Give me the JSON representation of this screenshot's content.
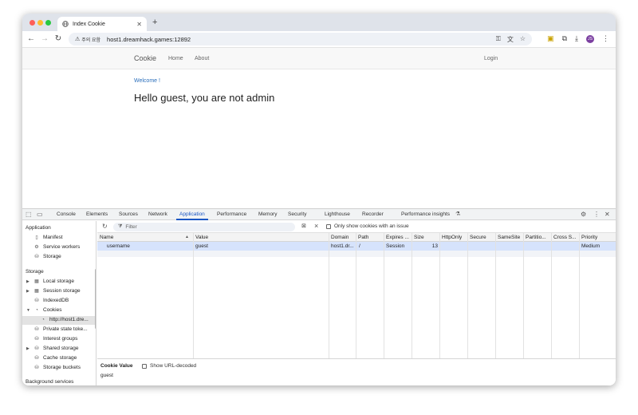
{
  "browser": {
    "tab_title": "Index Cookie",
    "new_tab": "+",
    "tab_close": "✕",
    "security_warning": "주의 요함",
    "url": "host1.dreamhack.games:12892",
    "profile_initials": "JS"
  },
  "page": {
    "brand": "Cookie",
    "nav": {
      "home": "Home",
      "about": "About",
      "login": "Login"
    },
    "welcome": "Welcome !",
    "message": "Hello guest, you are not admin"
  },
  "devtools": {
    "tabs": [
      "Console",
      "Elements",
      "Sources",
      "Network",
      "Application",
      "Performance",
      "Memory",
      "Security",
      "Lighthouse",
      "Recorder",
      "Performance insights"
    ],
    "active_tab": "Application",
    "sidebar": {
      "application_heading": "Application",
      "application_items": [
        "Manifest",
        "Service workers",
        "Storage"
      ],
      "storage_heading": "Storage",
      "storage_items": [
        "Local storage",
        "Session storage",
        "IndexedDB",
        "Cookies",
        "http://host1.dre...",
        "Private state toke...",
        "Interest groups",
        "Shared storage",
        "Cache storage",
        "Storage buckets"
      ],
      "background_heading": "Background services"
    },
    "filter": {
      "placeholder": "Filter",
      "issue_checkbox_label": "Only show cookies with an issue"
    },
    "columns": [
      "Name",
      "Value",
      "Domain",
      "Path",
      "Expires ...",
      "Size",
      "HttpOnly",
      "Secure",
      "SameSite",
      "Partitio...",
      "Cross S...",
      "Priority"
    ],
    "cookies": [
      {
        "name": "username",
        "value": "guest",
        "domain": "host1.dr...",
        "path": "/",
        "expires": "Session",
        "size": "13",
        "httponly": "",
        "secure": "",
        "samesite": "",
        "partition": "",
        "cross_site": "",
        "priority": "Medium"
      }
    ],
    "cookie_value_label": "Cookie Value",
    "show_decoded_label": "Show URL-decoded",
    "cookie_value": "guest"
  }
}
